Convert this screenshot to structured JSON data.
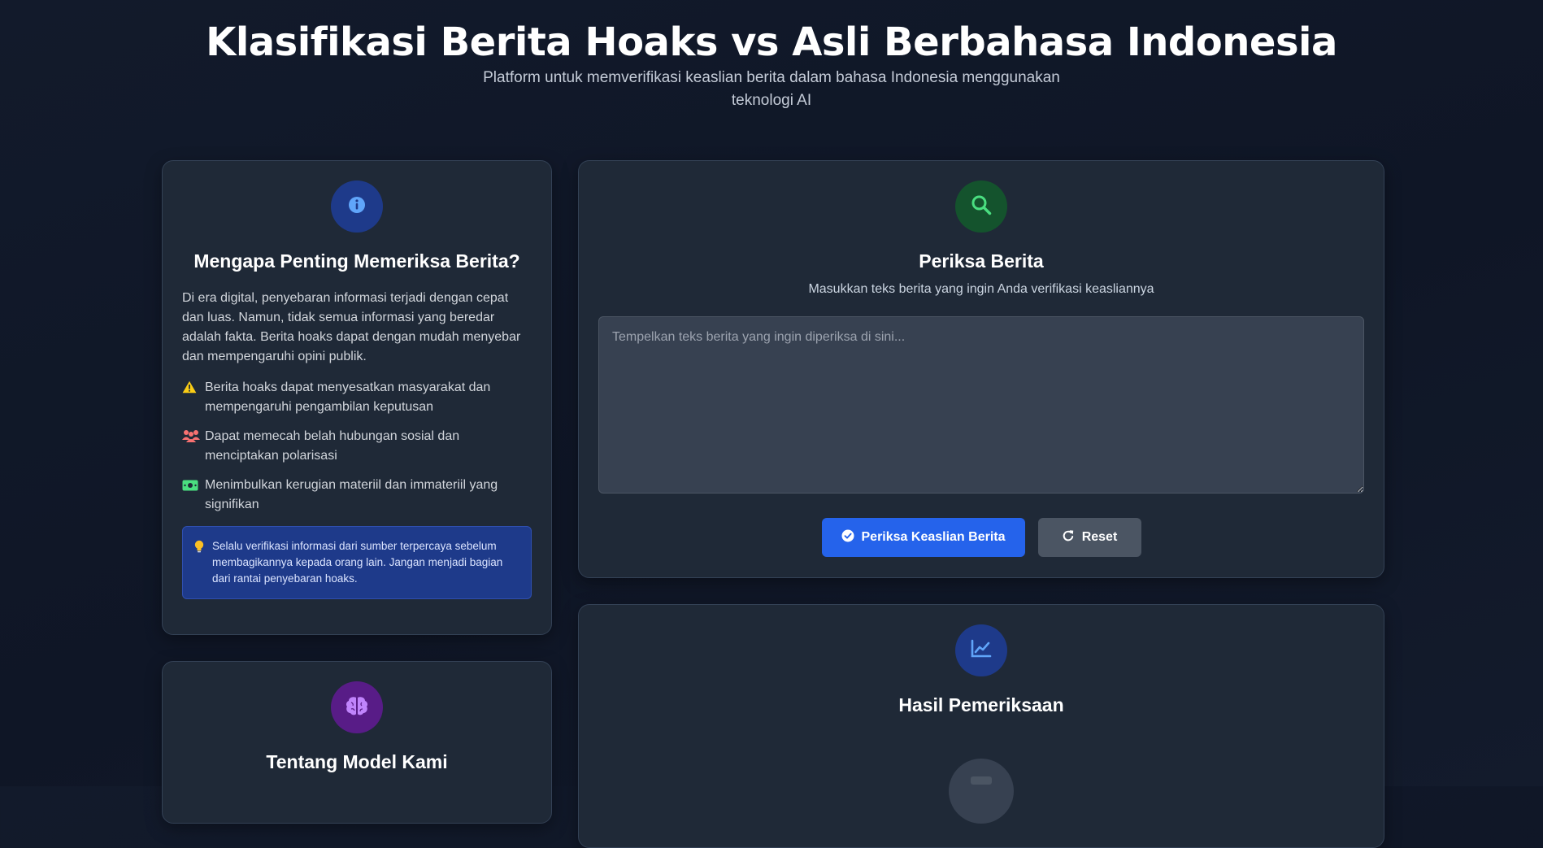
{
  "header": {
    "title": "Klasifikasi Berita Hoaks vs Asli Berbahasa Indonesia",
    "subtitle": "Platform untuk memverifikasi keaslian berita dalam bahasa Indonesia menggunakan teknologi AI"
  },
  "info_card": {
    "icon": "info-icon",
    "title": "Mengapa Penting Memeriksa Berita?",
    "paragraph": "Di era digital, penyebaran informasi terjadi dengan cepat dan luas. Namun, tidak semua informasi yang beredar adalah fakta. Berita hoaks dapat dengan mudah menyebar dan mempengaruhi opini publik.",
    "risks": [
      {
        "icon": "warning-icon",
        "color": "#facc15",
        "text": "Berita hoaks dapat menyesatkan masyarakat dan mempengaruhi pengambilan keputusan"
      },
      {
        "icon": "people-icon",
        "color": "#f87171",
        "text": "Dapat memecah belah hubungan sosial dan menciptakan polarisasi"
      },
      {
        "icon": "money-icon",
        "color": "#4ade80",
        "text": "Menimbulkan kerugian materiil dan immateriil yang signifikan"
      }
    ],
    "tip_icon": "lightbulb-icon",
    "tip": "Selalu verifikasi informasi dari sumber terpercaya sebelum membagikannya kepada orang lain. Jangan menjadi bagian dari rantai penyebaran hoaks."
  },
  "model_card": {
    "icon": "brain-icon",
    "title": "Tentang Model Kami"
  },
  "check_card": {
    "icon": "search-icon",
    "title": "Periksa Berita",
    "description": "Masukkan teks berita yang ingin Anda verifikasi keasliannya",
    "input_value": "",
    "input_placeholder": "Tempelkan teks berita yang ingin diperiksa di sini...",
    "check_button": "Periksa Keaslian Berita",
    "reset_button": "Reset"
  },
  "result_card": {
    "icon": "chart-line-icon",
    "title": "Hasil Pemeriksaan"
  },
  "colors": {
    "background": "#111827",
    "card": "#1f2937",
    "primary": "#2563eb",
    "secondary": "#4b5563",
    "info_icon_bg": "#1e3a8a",
    "check_icon_bg": "#14532d",
    "model_icon_bg": "#581c87"
  }
}
